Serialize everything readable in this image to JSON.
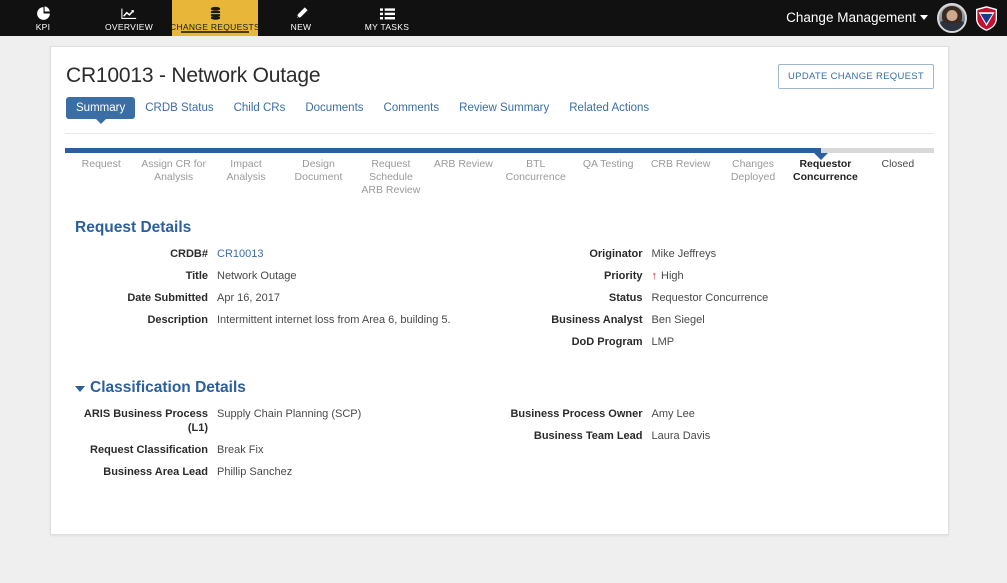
{
  "topnav": {
    "items": [
      {
        "label": "KPI",
        "icon": "pie-chart-icon",
        "active": false
      },
      {
        "label": "OVERVIEW",
        "icon": "line-chart-icon",
        "active": false
      },
      {
        "label": "CHANGE REQUESTS",
        "icon": "database-icon",
        "active": true
      },
      {
        "label": "NEW",
        "icon": "pencil-icon",
        "active": false
      },
      {
        "label": "MY TASKS",
        "icon": "list-icon",
        "active": false
      }
    ],
    "app_title": "Change Management",
    "avatar_name": "user-avatar",
    "logo_name": "shield-logo",
    "active_color": "#e8b73a",
    "bg_color": "#111111"
  },
  "header": {
    "page_title": "CR10013 - Network Outage",
    "update_button": "UPDATE CHANGE REQUEST"
  },
  "tabs": [
    {
      "label": "Summary",
      "active": true
    },
    {
      "label": "CRDB Status",
      "active": false
    },
    {
      "label": "Child CRs",
      "active": false
    },
    {
      "label": "Documents",
      "active": false
    },
    {
      "label": "Comments",
      "active": false
    },
    {
      "label": "Review Summary",
      "active": false
    },
    {
      "label": "Related Actions",
      "active": false
    }
  ],
  "stepper": {
    "progress_percent": 87,
    "current_step": "Requestor Concurrence",
    "steps": [
      {
        "label": "Request",
        "state": "done"
      },
      {
        "label": "Assign CR for Analysis",
        "state": "done"
      },
      {
        "label": "Impact Analysis",
        "state": "done"
      },
      {
        "label": "Design Document",
        "state": "done"
      },
      {
        "label": "Request Schedule ARB Review",
        "state": "done"
      },
      {
        "label": "ARB Review",
        "state": "done"
      },
      {
        "label": "BTL Concurrence",
        "state": "done"
      },
      {
        "label": "QA Testing",
        "state": "done"
      },
      {
        "label": "CRB Review",
        "state": "done"
      },
      {
        "label": "Changes Deployed",
        "state": "done"
      },
      {
        "label": "Requestor Concurrence",
        "state": "current"
      },
      {
        "label": "Closed",
        "state": "future"
      }
    ]
  },
  "request_details": {
    "heading": "Request Details",
    "left": [
      {
        "label": "CRDB#",
        "value": "CR10013",
        "is_link": true
      },
      {
        "label": "Title",
        "value": "Network Outage",
        "is_link": false
      },
      {
        "label": "Date Submitted",
        "value": "Apr 16, 2017",
        "is_link": false
      },
      {
        "label": "Description",
        "value": "Intermittent internet loss from Area 6, building 5.",
        "is_link": false
      }
    ],
    "right": [
      {
        "label": "Originator",
        "value": "Mike Jeffreys",
        "is_link": false
      },
      {
        "label": "Priority",
        "value": "High",
        "is_link": false,
        "icon": "priority-up-arrow-icon",
        "icon_glyph": "↑",
        "icon_color": "#cc2027"
      },
      {
        "label": "Status",
        "value": "Requestor Concurrence",
        "is_link": false
      },
      {
        "label": "Business Analyst",
        "value": "Ben Siegel",
        "is_link": false
      },
      {
        "label": "DoD Program",
        "value": "LMP",
        "is_link": false
      }
    ]
  },
  "classification_details": {
    "heading": "Classification Details",
    "collapsed": false,
    "left": [
      {
        "label": "ARIS Business Process (L1)",
        "value": "Supply Chain Planning (SCP)"
      },
      {
        "label": "Request Classification",
        "value": "Break Fix"
      },
      {
        "label": "Business Area Lead",
        "value": "Phillip Sanchez"
      }
    ],
    "right": [
      {
        "label": "Business Process Owner",
        "value": "Amy Lee"
      },
      {
        "label": "Business Team Lead",
        "value": "Laura Davis"
      }
    ]
  }
}
